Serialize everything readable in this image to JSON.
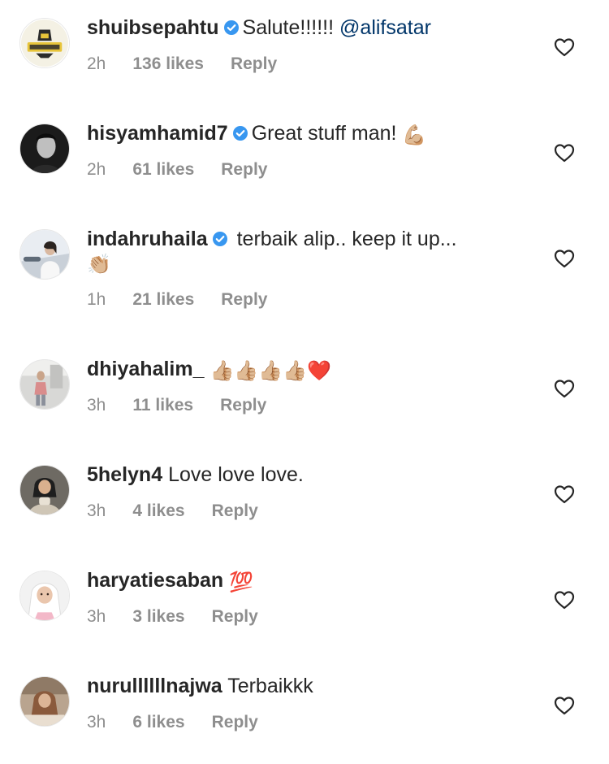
{
  "comments": [
    {
      "username": "shuibsepahtu",
      "verified": true,
      "text": "Salute!!!!!! ",
      "mention": "@alifsatar",
      "emoji": "",
      "time": "2h",
      "likes": "136 likes",
      "reply": "Reply",
      "avatar_icon": "honey-jumia-logo-avatar"
    },
    {
      "username": "hisyamhamid7",
      "verified": true,
      "text": "Great stuff man! ",
      "mention": "",
      "emoji": "💪🏼",
      "time": "2h",
      "likes": "61 likes",
      "reply": "Reply",
      "avatar_icon": "man-portrait-avatar"
    },
    {
      "username": "indahruhaila",
      "verified": true,
      "text": "terbaik alip.. keep it up...",
      "mention": "",
      "emoji": "👏🏼",
      "time": "1h",
      "likes": "21 likes",
      "reply": "Reply",
      "avatar_icon": "woman-in-car-avatar"
    },
    {
      "username": "dhiyahalim_",
      "verified": false,
      "text": "",
      "mention": "",
      "emoji": "👍🏼👍🏼👍🏼👍🏼❤️",
      "time": "3h",
      "likes": "11 likes",
      "reply": "Reply",
      "avatar_icon": "woman-standing-avatar"
    },
    {
      "username": "5helyn4",
      "verified": false,
      "text": "Love love love.",
      "mention": "",
      "emoji": "",
      "time": "3h",
      "likes": "4 likes",
      "reply": "Reply",
      "avatar_icon": "woman-hijab-dark-avatar"
    },
    {
      "username": "haryatiesaban",
      "verified": false,
      "text": "",
      "mention": "",
      "emoji": "💯",
      "time": "3h",
      "likes": "3 likes",
      "reply": "Reply",
      "avatar_icon": "woman-hijab-white-avatar"
    },
    {
      "username": "nurullllllnajwa",
      "verified": false,
      "text": "Terbaikkk",
      "mention": "",
      "emoji": "",
      "time": "3h",
      "likes": "6 likes",
      "reply": "Reply",
      "avatar_icon": "woman-hijab-brown-avatar"
    }
  ],
  "colors": {
    "text": "#262626",
    "meta": "#8e8e8e",
    "mention": "#003569",
    "verified": "#3897f0"
  },
  "icons": {
    "verified": "verified-badge-icon",
    "like": "heart-outline-icon"
  }
}
